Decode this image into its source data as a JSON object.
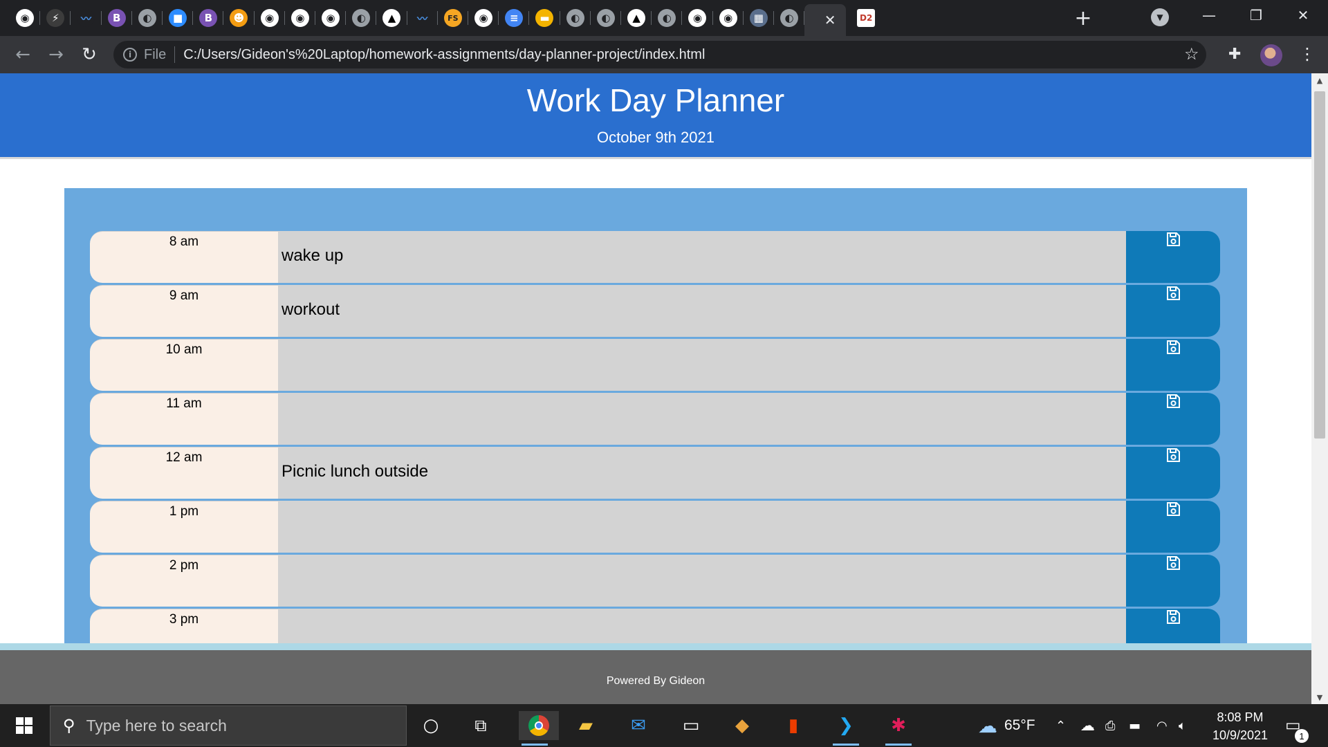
{
  "browser": {
    "tabs": [
      {
        "icon": "github-icon",
        "glyph": "◉",
        "bg": "#ffffff",
        "fg": "#202124"
      },
      {
        "icon": "zigzag-icon",
        "glyph": "⚡",
        "bg": "#3c3c3c",
        "fg": "#ffffff"
      },
      {
        "icon": "wave-icon",
        "glyph": "〰",
        "bg": "#202124",
        "fg": "#4a90e2"
      },
      {
        "icon": "bootstrap-icon",
        "glyph": "B",
        "bg": "#7952b3",
        "fg": "#ffffff"
      },
      {
        "icon": "globe-icon",
        "glyph": "◐",
        "bg": "#9aa0a6",
        "fg": "#202124"
      },
      {
        "icon": "zoom-icon",
        "glyph": "■",
        "bg": "#2d8cff",
        "fg": "#ffffff"
      },
      {
        "icon": "bootstrap-icon",
        "glyph": "B",
        "bg": "#7952b3",
        "fg": "#ffffff"
      },
      {
        "icon": "shield-icon",
        "glyph": "☻",
        "bg": "#f39c12",
        "fg": "#ffffff"
      },
      {
        "icon": "github-icon",
        "glyph": "◉",
        "bg": "#ffffff",
        "fg": "#202124"
      },
      {
        "icon": "github-icon",
        "glyph": "◉",
        "bg": "#ffffff",
        "fg": "#202124"
      },
      {
        "icon": "github-icon",
        "glyph": "◉",
        "bg": "#ffffff",
        "fg": "#202124"
      },
      {
        "icon": "globe-icon",
        "glyph": "◐",
        "bg": "#9aa0a6",
        "fg": "#202124"
      },
      {
        "icon": "graduation-cap-icon",
        "glyph": "▲",
        "bg": "#ffffff",
        "fg": "#000000"
      },
      {
        "icon": "wave-icon",
        "glyph": "〰",
        "bg": "#202124",
        "fg": "#4a90e2"
      },
      {
        "icon": "fs-icon",
        "glyph": "FS",
        "bg": "#f5a623",
        "fg": "#202124"
      },
      {
        "icon": "github-icon",
        "glyph": "◉",
        "bg": "#ffffff",
        "fg": "#202124"
      },
      {
        "icon": "docs-icon",
        "glyph": "≡",
        "bg": "#4285f4",
        "fg": "#ffffff"
      },
      {
        "icon": "slides-icon",
        "glyph": "▬",
        "bg": "#f4b400",
        "fg": "#ffffff"
      },
      {
        "icon": "globe-icon",
        "glyph": "◐",
        "bg": "#9aa0a6",
        "fg": "#202124"
      },
      {
        "icon": "globe-icon",
        "glyph": "◐",
        "bg": "#9aa0a6",
        "fg": "#202124"
      },
      {
        "icon": "graduation-cap-icon",
        "glyph": "▲",
        "bg": "#ffffff",
        "fg": "#000000"
      },
      {
        "icon": "globe-icon",
        "glyph": "◐",
        "bg": "#9aa0a6",
        "fg": "#202124"
      },
      {
        "icon": "github-icon",
        "glyph": "◉",
        "bg": "#ffffff",
        "fg": "#202124"
      },
      {
        "icon": "github-icon",
        "glyph": "◉",
        "bg": "#ffffff",
        "fg": "#202124"
      },
      {
        "icon": "picture-icon",
        "glyph": "▦",
        "bg": "#5a6e8c",
        "fg": "#ffffff"
      },
      {
        "icon": "globe-icon",
        "glyph": "◐",
        "bg": "#9aa0a6",
        "fg": "#202124"
      }
    ],
    "active_tab_close": "✕",
    "after_tab": {
      "icon": "d2l-icon",
      "glyph": "D2",
      "bg": "#ffffff",
      "fg": "#c0392b"
    },
    "new_tab": "+",
    "address": {
      "scheme_label": "File",
      "url": "C:/Users/Gideon's%20Laptop/homework-assignments/day-planner-project/index.html"
    }
  },
  "page": {
    "title": "Work Day Planner",
    "date": "October 9th 2021",
    "footer": "Powered By Gideon",
    "rows": [
      {
        "hour": "8 am",
        "text": "wake up"
      },
      {
        "hour": "9 am",
        "text": "workout"
      },
      {
        "hour": "10 am",
        "text": ""
      },
      {
        "hour": "11 am",
        "text": ""
      },
      {
        "hour": "12 am",
        "text": "Picnic lunch outside"
      },
      {
        "hour": "1 pm",
        "text": ""
      },
      {
        "hour": "2 pm",
        "text": ""
      },
      {
        "hour": "3 pm",
        "text": ""
      }
    ]
  },
  "taskbar": {
    "search_placeholder": "Type here to search",
    "weather": "65°F",
    "time": "8:08 PM",
    "date": "10/9/2021",
    "notifications": "1"
  }
}
